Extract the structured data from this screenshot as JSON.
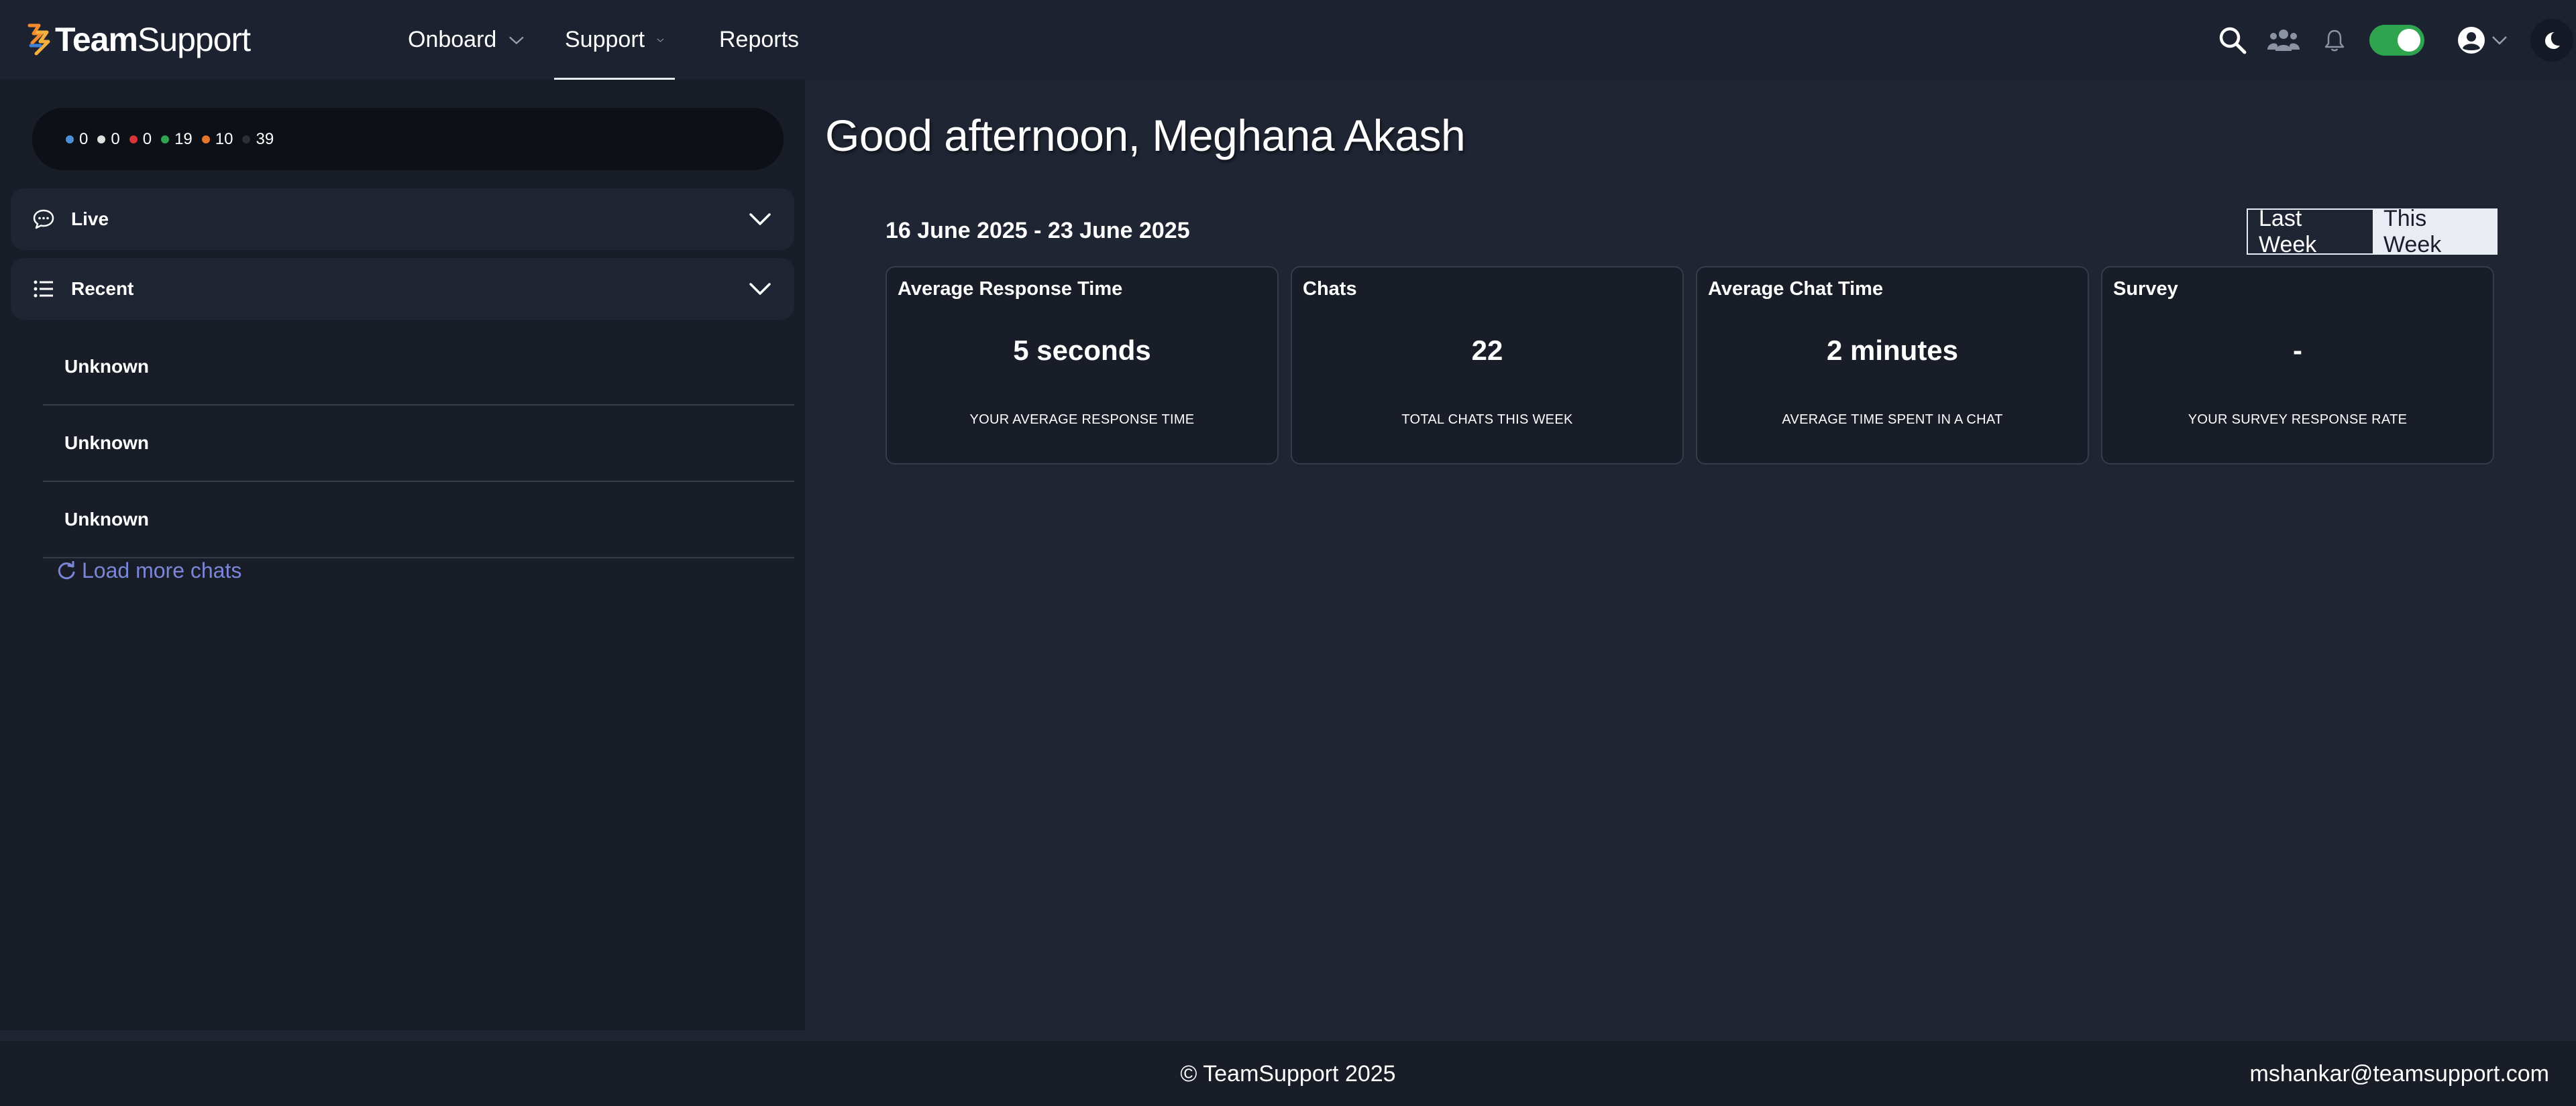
{
  "brand": {
    "name_bold": "Team",
    "name_light": "Support"
  },
  "nav": {
    "items": [
      {
        "label": "Onboard"
      },
      {
        "label": "Support"
      },
      {
        "label": "Reports"
      }
    ]
  },
  "header_icons": [
    "search-icon",
    "people-icon",
    "bell-icon",
    "toggle",
    "user-circle-icon",
    "moon-icon"
  ],
  "sidebar": {
    "status_counts": [
      {
        "value": "0",
        "color": "#4a90d9"
      },
      {
        "value": "0",
        "color": "#e0e0e0"
      },
      {
        "value": "0",
        "color": "#d93636"
      },
      {
        "value": "19",
        "color": "#2ea44f"
      },
      {
        "value": "10",
        "color": "#e8742a"
      },
      {
        "value": "39",
        "color": "#2a2f3a"
      }
    ],
    "live_label": "Live",
    "recent_label": "Recent",
    "chats": [
      {
        "name": "Unknown"
      },
      {
        "name": "Unknown"
      },
      {
        "name": "Unknown"
      }
    ],
    "load_more": "Load more chats"
  },
  "main": {
    "greeting": "Good afternoon, Meghana Akash",
    "date_range": "16 June 2025 - 23 June 2025",
    "week_toggle": {
      "last": "Last Week",
      "this": "This Week",
      "selected": "This Week"
    },
    "cards": [
      {
        "title": "Average Response Time",
        "value": "5 seconds",
        "subtitle": "YOUR AVERAGE RESPONSE TIME"
      },
      {
        "title": "Chats",
        "value": "22",
        "subtitle": "TOTAL CHATS THIS WEEK"
      },
      {
        "title": "Average Chat Time",
        "value": "2 minutes",
        "subtitle": "AVERAGE TIME SPENT IN A CHAT"
      },
      {
        "title": "Survey",
        "value": "-",
        "subtitle": "YOUR SURVEY RESPONSE RATE"
      }
    ]
  },
  "footer": {
    "copyright": "© TeamSupport 2025",
    "email": "mshankar@teamsupport.com"
  },
  "colors": {
    "background": "#1f2533",
    "sidebar": "#181d27",
    "accent_link": "#7b86d8",
    "toggle_on": "#2ea44f"
  }
}
